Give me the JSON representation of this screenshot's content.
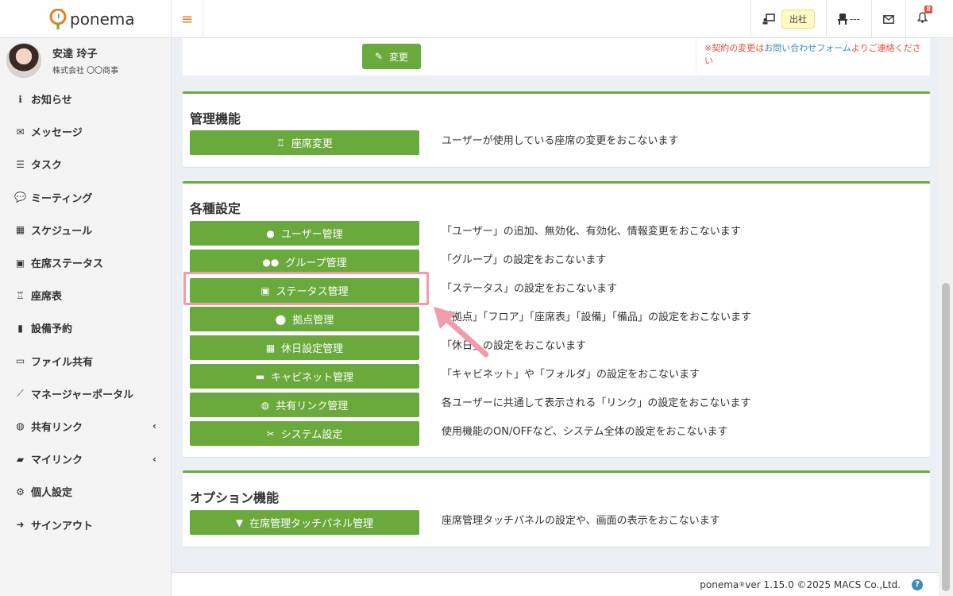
{
  "header": {
    "app_name": "ponema",
    "status_label": "出社",
    "seat_label": "---"
  },
  "notifications": {
    "badge_count": "8"
  },
  "user": {
    "name": "安達 玲子",
    "company": "株式会社 〇〇商事"
  },
  "sidebar": {
    "items": [
      {
        "label": "お知らせ",
        "icon": "info-circle-icon"
      },
      {
        "label": "メッセージ",
        "icon": "envelope-icon"
      },
      {
        "label": "タスク",
        "icon": "tasks-icon"
      },
      {
        "label": "ミーティング",
        "icon": "comments-icon"
      },
      {
        "label": "スケジュール",
        "icon": "calendar-icon"
      },
      {
        "label": "在席ステータス",
        "icon": "chalkboard-user-icon"
      },
      {
        "label": "座席表",
        "icon": "chair-icon"
      },
      {
        "label": "設備予約",
        "icon": "book-icon"
      },
      {
        "label": "ファイル共有",
        "icon": "folder-open-icon"
      },
      {
        "label": "マネージャーポータル",
        "icon": "chart-line-icon"
      },
      {
        "label": "共有リンク",
        "icon": "globe-icon"
      },
      {
        "label": "マイリンク",
        "icon": "bookmark-icon"
      },
      {
        "label": "個人設定",
        "icon": "gear-icon"
      },
      {
        "label": "サインアウト",
        "icon": "sign-out-icon"
      }
    ]
  },
  "contract_panel": {
    "change_button": "変更",
    "notice_prefix": "※契約の変更は",
    "notice_link": "お問い合わせフォーム",
    "notice_suffix": "よりご連絡ください"
  },
  "management": {
    "title": "管理機能",
    "buttons": [
      {
        "label": "座席変更",
        "desc": "ユーザーが使用している座席の変更をおこないます"
      }
    ]
  },
  "settings": {
    "title": "各種設定",
    "buttons": [
      {
        "label": "ユーザー管理",
        "desc": "「ユーザー」の追加、無効化、有効化、情報変更をおこないます"
      },
      {
        "label": "グループ管理",
        "desc": "「グループ」の設定をおこないます"
      },
      {
        "label": "ステータス管理",
        "desc": "「ステータス」の設定をおこないます"
      },
      {
        "label": "拠点管理",
        "desc": "「拠点」「フロア」「座席表」「設備」「備品」の設定をおこないます"
      },
      {
        "label": "休日設定管理",
        "desc": "「休日」の設定をおこないます"
      },
      {
        "label": "キャビネット管理",
        "desc": "「キャビネット」や「フォルダ」の設定をおこないます"
      },
      {
        "label": "共有リンク管理",
        "desc": "各ユーザーに共通して表示される「リンク」の設定をおこないます"
      },
      {
        "label": "システム設定",
        "desc": "使用機能のON/OFFなど、システム全体の設定をおこないます"
      }
    ]
  },
  "options": {
    "title": "オプション機能",
    "buttons": [
      {
        "label": "在席管理タッチパネル管理",
        "desc": "座席管理タッチパネルの設定や、画面の表示をおこないます"
      }
    ]
  },
  "footer": {
    "product": "ponema",
    "registered": "®",
    "version_text": " ver 1.15.0 ©2025 MACS Co.,Ltd.",
    "help": "?"
  },
  "colors": {
    "accent_green": "#6aaa3c",
    "highlight_pink": "#f29bab",
    "orange": "#e67e22"
  }
}
